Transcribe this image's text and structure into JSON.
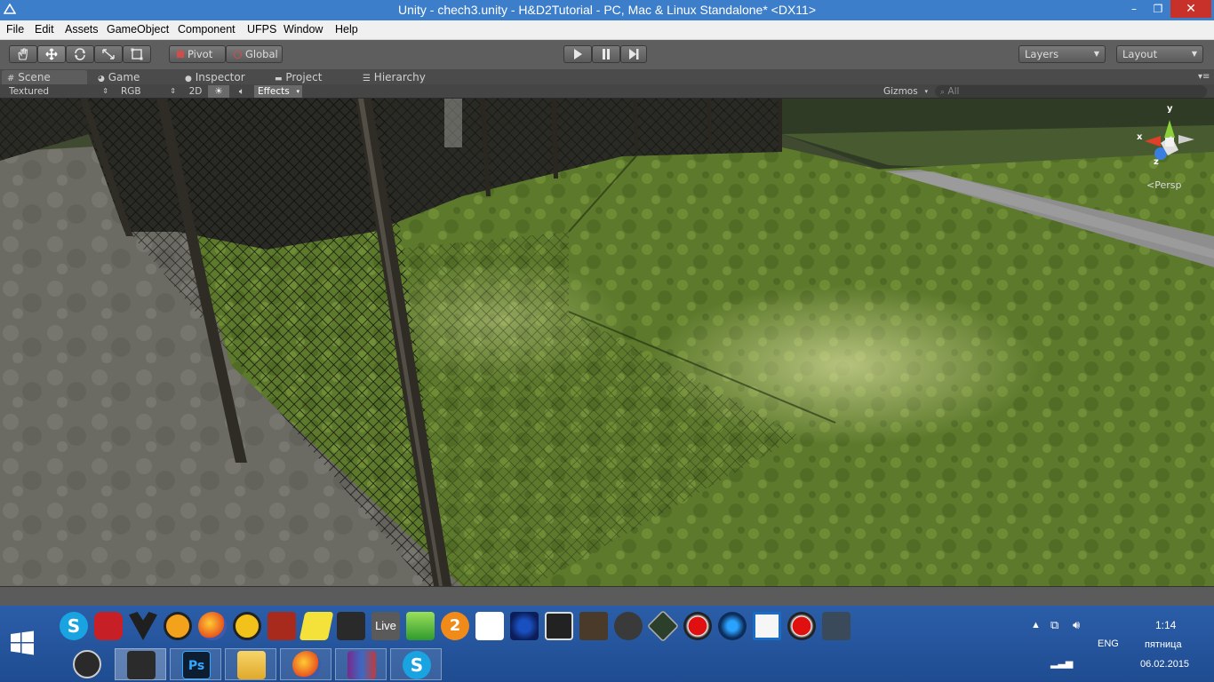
{
  "window": {
    "title": "Unity - chech3.unity - H&D2Tutorial - PC, Mac & Linux Standalone* <DX11>",
    "minimize": "–",
    "maximize": "❐",
    "close": "✕"
  },
  "menu": [
    "File",
    "Edit",
    "Assets",
    "GameObject",
    "Component",
    "UFPS",
    "Window",
    "Help"
  ],
  "toolbar": {
    "pivot_label": "Pivot",
    "global_label": "Global",
    "layers_label": "Layers",
    "layout_label": "Layout"
  },
  "tabs": {
    "scene": "Scene",
    "game": "Game",
    "inspector": "Inspector",
    "project": "Project",
    "hierarchy": "Hierarchy"
  },
  "scene_options": {
    "render_mode": "Textured",
    "color_mode": "RGB",
    "mode_2d": "2D",
    "effects": "Effects",
    "gizmos": "Gizmos",
    "search_placeholder": "All"
  },
  "gizmo": {
    "x_label": "x",
    "y_label": "y",
    "z_label": "z",
    "projection": "Persp"
  },
  "taskbar": {
    "live_label": "Live",
    "ps_label": "Ps",
    "language": "ENG",
    "time": "1:14",
    "weekday": "пятница",
    "date": "06.02.2015"
  },
  "colors": {
    "titlebar": "#3c7ec9",
    "close_button": "#c7312a",
    "taskbar": "#2459a6",
    "gizmo_x": "#e0402a",
    "gizmo_y": "#8cd03a",
    "gizmo_z": "#3a7fe0"
  }
}
